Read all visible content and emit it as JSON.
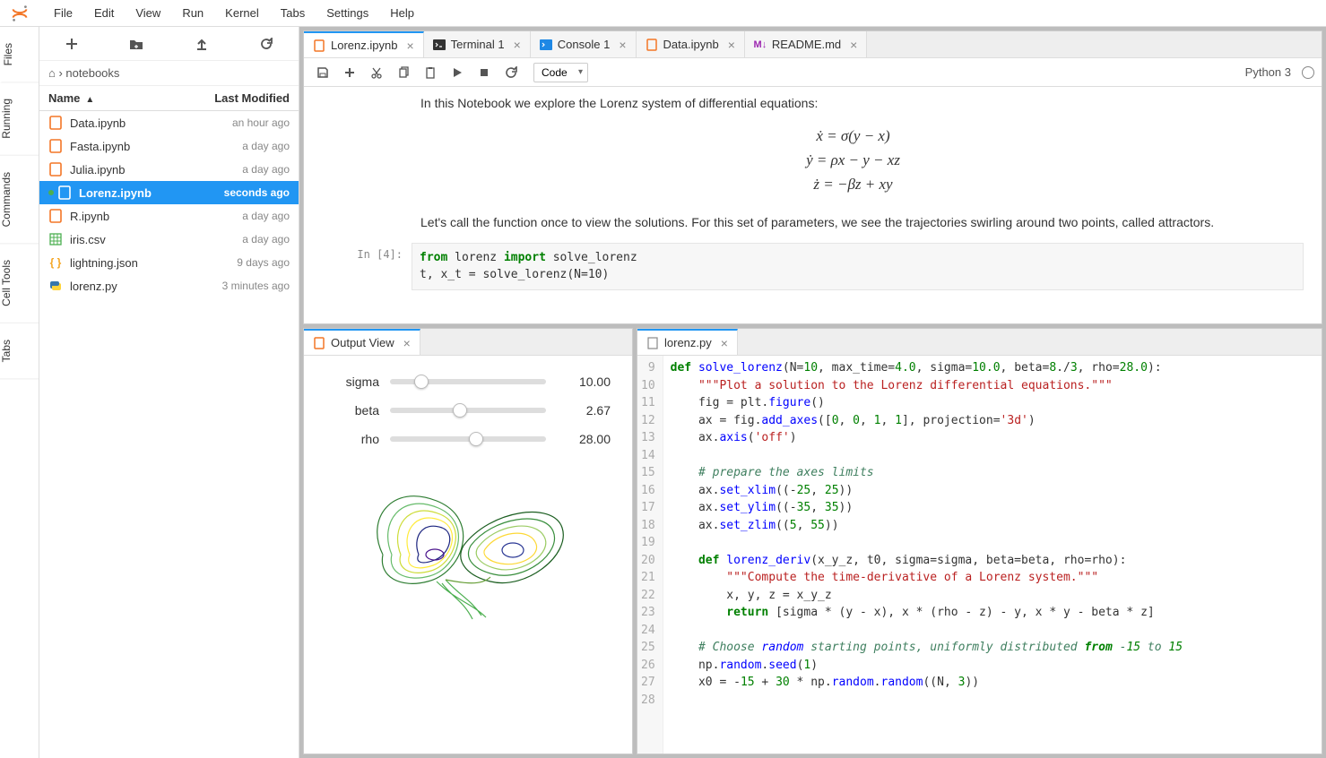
{
  "menu": {
    "items": [
      "File",
      "Edit",
      "View",
      "Run",
      "Kernel",
      "Tabs",
      "Settings",
      "Help"
    ]
  },
  "leftTabs": [
    "Files",
    "Running",
    "Commands",
    "Cell Tools",
    "Tabs"
  ],
  "fileBrowser": {
    "breadcrumb": "notebooks",
    "headers": {
      "name": "Name",
      "modified": "Last Modified"
    },
    "files": [
      {
        "name": "Data.ipynb",
        "modified": "an hour ago",
        "type": "nb",
        "running": false,
        "selected": false
      },
      {
        "name": "Fasta.ipynb",
        "modified": "a day ago",
        "type": "nb",
        "running": false,
        "selected": false
      },
      {
        "name": "Julia.ipynb",
        "modified": "a day ago",
        "type": "nb",
        "running": false,
        "selected": false
      },
      {
        "name": "Lorenz.ipynb",
        "modified": "seconds ago",
        "type": "nb",
        "running": true,
        "selected": true
      },
      {
        "name": "R.ipynb",
        "modified": "a day ago",
        "type": "nb",
        "running": false,
        "selected": false
      },
      {
        "name": "iris.csv",
        "modified": "a day ago",
        "type": "csv",
        "running": false,
        "selected": false
      },
      {
        "name": "lightning.json",
        "modified": "9 days ago",
        "type": "json",
        "running": false,
        "selected": false
      },
      {
        "name": "lorenz.py",
        "modified": "3 minutes ago",
        "type": "py",
        "running": false,
        "selected": false
      }
    ]
  },
  "mainTabs": [
    {
      "label": "Lorenz.ipynb",
      "type": "nb",
      "active": true
    },
    {
      "label": "Terminal 1",
      "type": "term",
      "active": false
    },
    {
      "label": "Console 1",
      "type": "console",
      "active": false
    },
    {
      "label": "Data.ipynb",
      "type": "nb",
      "active": false
    },
    {
      "label": "README.md",
      "type": "md",
      "active": false
    }
  ],
  "nbToolbar": {
    "cellType": "Code"
  },
  "kernel": {
    "name": "Python 3"
  },
  "notebookContent": {
    "intro": "In this Notebook we explore the Lorenz system of differential equations:",
    "eq1": "ẋ = σ(y − x)",
    "eq2": "ẏ = ρx − y − xz",
    "eq3": "ż = −βz + xy",
    "para2": "Let's call the function once to view the solutions. For this set of parameters, we see the trajectories swirling around two points, called attractors.",
    "prompt": "In [4]:",
    "code_line1_kw": "from",
    "code_line1_mod": "lorenz",
    "code_line1_kw2": "import",
    "code_line1_sym": "solve_lorenz",
    "code_line2": "t, x_t = solve_lorenz(N=10)"
  },
  "outputView": {
    "tabLabel": "Output View",
    "sliders": [
      {
        "name": "sigma",
        "value": "10.00",
        "pos": 20
      },
      {
        "name": "beta",
        "value": "2.67",
        "pos": 45
      },
      {
        "name": "rho",
        "value": "28.00",
        "pos": 55
      }
    ]
  },
  "editor": {
    "tabLabel": "lorenz.py",
    "startLine": 9,
    "lines": [
      "def solve_lorenz(N=10, max_time=4.0, sigma=10.0, beta=8./3, rho=28.0):",
      "    \"\"\"Plot a solution to the Lorenz differential equations.\"\"\"",
      "    fig = plt.figure()",
      "    ax = fig.add_axes([0, 0, 1, 1], projection='3d')",
      "    ax.axis('off')",
      "",
      "    # prepare the axes limits",
      "    ax.set_xlim((-25, 25))",
      "    ax.set_ylim((-35, 35))",
      "    ax.set_zlim((5, 55))",
      "",
      "    def lorenz_deriv(x_y_z, t0, sigma=sigma, beta=beta, rho=rho):",
      "        \"\"\"Compute the time-derivative of a Lorenz system.\"\"\"",
      "        x, y, z = x_y_z",
      "        return [sigma * (y - x), x * (rho - z) - y, x * y - beta * z]",
      "",
      "    # Choose random starting points, uniformly distributed from -15 to 15",
      "    np.random.seed(1)",
      "    x0 = -15 + 30 * np.random.random((N, 3))",
      ""
    ]
  }
}
